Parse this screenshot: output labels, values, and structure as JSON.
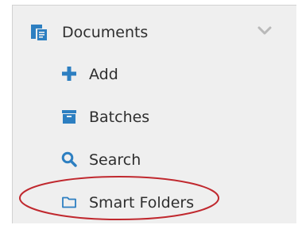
{
  "nav": {
    "header": {
      "label": "Documents",
      "icon": "documents-icon",
      "expand_icon": "chevron-down-icon"
    },
    "items": [
      {
        "label": "Add",
        "icon": "plus-icon"
      },
      {
        "label": "Batches",
        "icon": "archive-box-icon"
      },
      {
        "label": "Search",
        "icon": "magnifier-icon"
      },
      {
        "label": "Smart Folders",
        "icon": "folder-outline-icon"
      }
    ]
  },
  "colors": {
    "icon_blue": "#2d7fc1",
    "text": "#2f2f2f",
    "panel_bg": "#efefef",
    "chevron": "#b9b9b9",
    "annotation_red": "#c0282e"
  }
}
